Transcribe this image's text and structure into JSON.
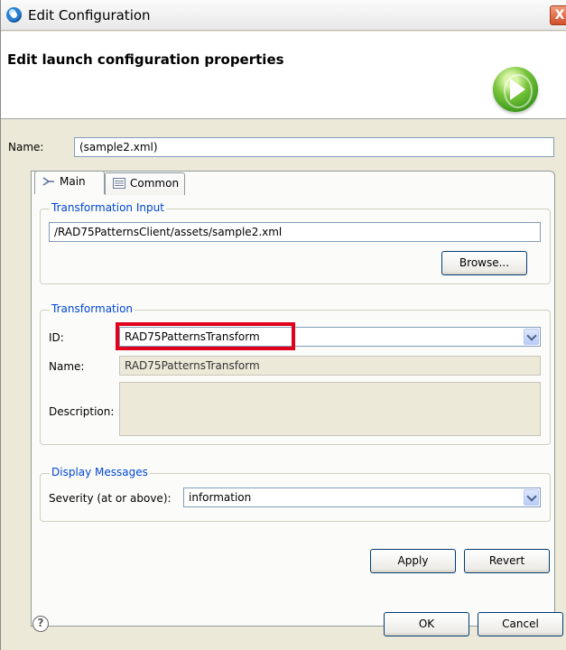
{
  "window": {
    "title": "Edit Configuration",
    "close_glyph": "X"
  },
  "header": {
    "heading": "Edit launch configuration properties",
    "icon": "run-icon"
  },
  "config": {
    "name_label": "Name:",
    "name_value": "(sample2.xml)"
  },
  "tabs": [
    {
      "label": "Main",
      "icon": "main-tab-icon",
      "active": true
    },
    {
      "label": "Common",
      "icon": "common-tab-icon",
      "active": false
    }
  ],
  "transformation_input": {
    "group_title": "Transformation Input",
    "path_value": "/RAD75PatternsClient/assets/sample2.xml",
    "browse_label": "Browse..."
  },
  "transformation": {
    "group_title": "Transformation",
    "id_label": "ID:",
    "id_value": "RAD75PatternsTransform",
    "name_label": "Name:",
    "name_value": "RAD75PatternsTransform",
    "description_label": "Description:",
    "description_value": ""
  },
  "display_messages": {
    "group_title": "Display Messages",
    "severity_label": "Severity (at or above):",
    "severity_value": "information"
  },
  "actions": {
    "apply_label": "Apply",
    "revert_label": "Revert",
    "ok_label": "OK",
    "cancel_label": "Cancel"
  },
  "help": {
    "glyph": "?"
  },
  "colors": {
    "group_title": "#0046d5",
    "highlight": "#e0001b",
    "dialog_bg": "#ece9d8"
  }
}
